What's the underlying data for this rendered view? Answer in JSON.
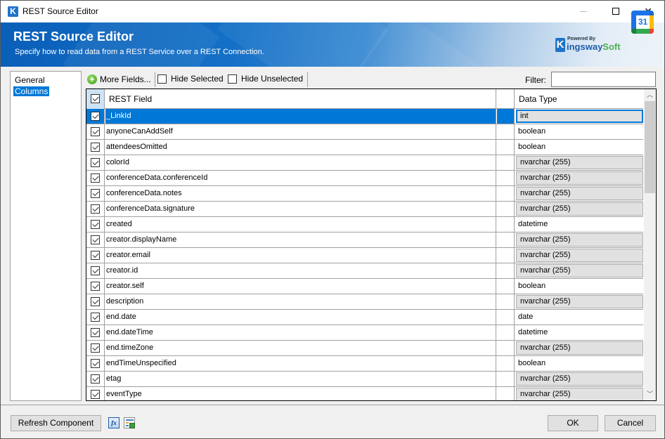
{
  "window": {
    "title": "REST Source Editor",
    "controls": {
      "minimize": "minimize",
      "maximize": "maximize",
      "close": "close"
    }
  },
  "banner": {
    "title": "REST Source Editor",
    "subtitle": "Specify how to read data from a REST Service over a REST Connection.",
    "logo": {
      "powered_by": "Powered By",
      "k": "K",
      "name_a": "ingsway",
      "name_b": "Soft"
    },
    "calendar_icon_day": "31"
  },
  "nav": {
    "items": [
      {
        "label": "General",
        "selected": false
      },
      {
        "label": "Columns",
        "selected": true
      }
    ]
  },
  "toolbar": {
    "more_fields": "More Fields...",
    "hide_selected": "Hide Selected",
    "hide_unselected": "Hide Unselected",
    "filter_label": "Filter:",
    "filter_value": ""
  },
  "grid": {
    "headers": {
      "field": "REST Field",
      "type": "Data Type"
    },
    "rows": [
      {
        "checked": true,
        "field": "_LinkId",
        "type": "int",
        "combo": true,
        "selected": true
      },
      {
        "checked": true,
        "field": "anyoneCanAddSelf",
        "type": "boolean",
        "combo": false
      },
      {
        "checked": true,
        "field": "attendeesOmitted",
        "type": "boolean",
        "combo": false
      },
      {
        "checked": true,
        "field": "colorId",
        "type": "nvarchar (255)",
        "combo": true
      },
      {
        "checked": true,
        "field": "conferenceData.conferenceId",
        "type": "nvarchar (255)",
        "combo": true
      },
      {
        "checked": true,
        "field": "conferenceData.notes",
        "type": "nvarchar (255)",
        "combo": true
      },
      {
        "checked": true,
        "field": "conferenceData.signature",
        "type": "nvarchar (255)",
        "combo": true
      },
      {
        "checked": true,
        "field": "created",
        "type": "datetime",
        "combo": false
      },
      {
        "checked": true,
        "field": "creator.displayName",
        "type": "nvarchar (255)",
        "combo": true
      },
      {
        "checked": true,
        "field": "creator.email",
        "type": "nvarchar (255)",
        "combo": true
      },
      {
        "checked": true,
        "field": "creator.id",
        "type": "nvarchar (255)",
        "combo": true
      },
      {
        "checked": true,
        "field": "creator.self",
        "type": "boolean",
        "combo": false
      },
      {
        "checked": true,
        "field": "description",
        "type": "nvarchar (255)",
        "combo": true
      },
      {
        "checked": true,
        "field": "end.date",
        "type": "date",
        "combo": false
      },
      {
        "checked": true,
        "field": "end.dateTime",
        "type": "datetime",
        "combo": false
      },
      {
        "checked": true,
        "field": "end.timeZone",
        "type": "nvarchar (255)",
        "combo": true
      },
      {
        "checked": true,
        "field": "endTimeUnspecified",
        "type": "boolean",
        "combo": false
      },
      {
        "checked": true,
        "field": "etag",
        "type": "nvarchar (255)",
        "combo": true
      },
      {
        "checked": true,
        "field": "eventType",
        "type": "nvarchar (255)",
        "combo": true
      }
    ],
    "scroll": {
      "up": "▲",
      "down": "▼"
    }
  },
  "footer": {
    "refresh": "Refresh Component",
    "expression_icon": "fx",
    "ok": "OK",
    "cancel": "Cancel"
  }
}
